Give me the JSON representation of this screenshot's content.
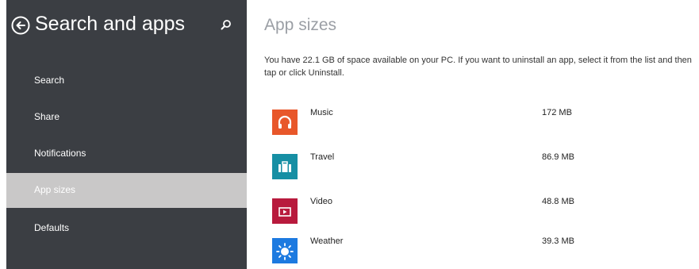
{
  "sidebar": {
    "title": "Search and apps",
    "items": [
      {
        "label": "Search",
        "selected": false
      },
      {
        "label": "Share",
        "selected": false
      },
      {
        "label": "Notifications",
        "selected": false
      },
      {
        "label": "App sizes",
        "selected": true
      },
      {
        "label": "Defaults",
        "selected": false
      }
    ]
  },
  "main": {
    "title": "App sizes",
    "description": "You have 22.1 GB of space available on your PC. If you want to uninstall an app, select it from the list and then tap or click Uninstall.",
    "apps": [
      {
        "name": "Music",
        "size": "172 MB",
        "icon": "headphones-icon",
        "color": "#e8572a"
      },
      {
        "name": "Travel",
        "size": "86.9 MB",
        "icon": "suitcase-icon",
        "color": "#168fa4"
      },
      {
        "name": "Video",
        "size": "48.8 MB",
        "icon": "video-icon",
        "color": "#b81a3d"
      },
      {
        "name": "Weather",
        "size": "39.3 MB",
        "icon": "sun-icon",
        "color": "#1d7ae0"
      }
    ]
  }
}
